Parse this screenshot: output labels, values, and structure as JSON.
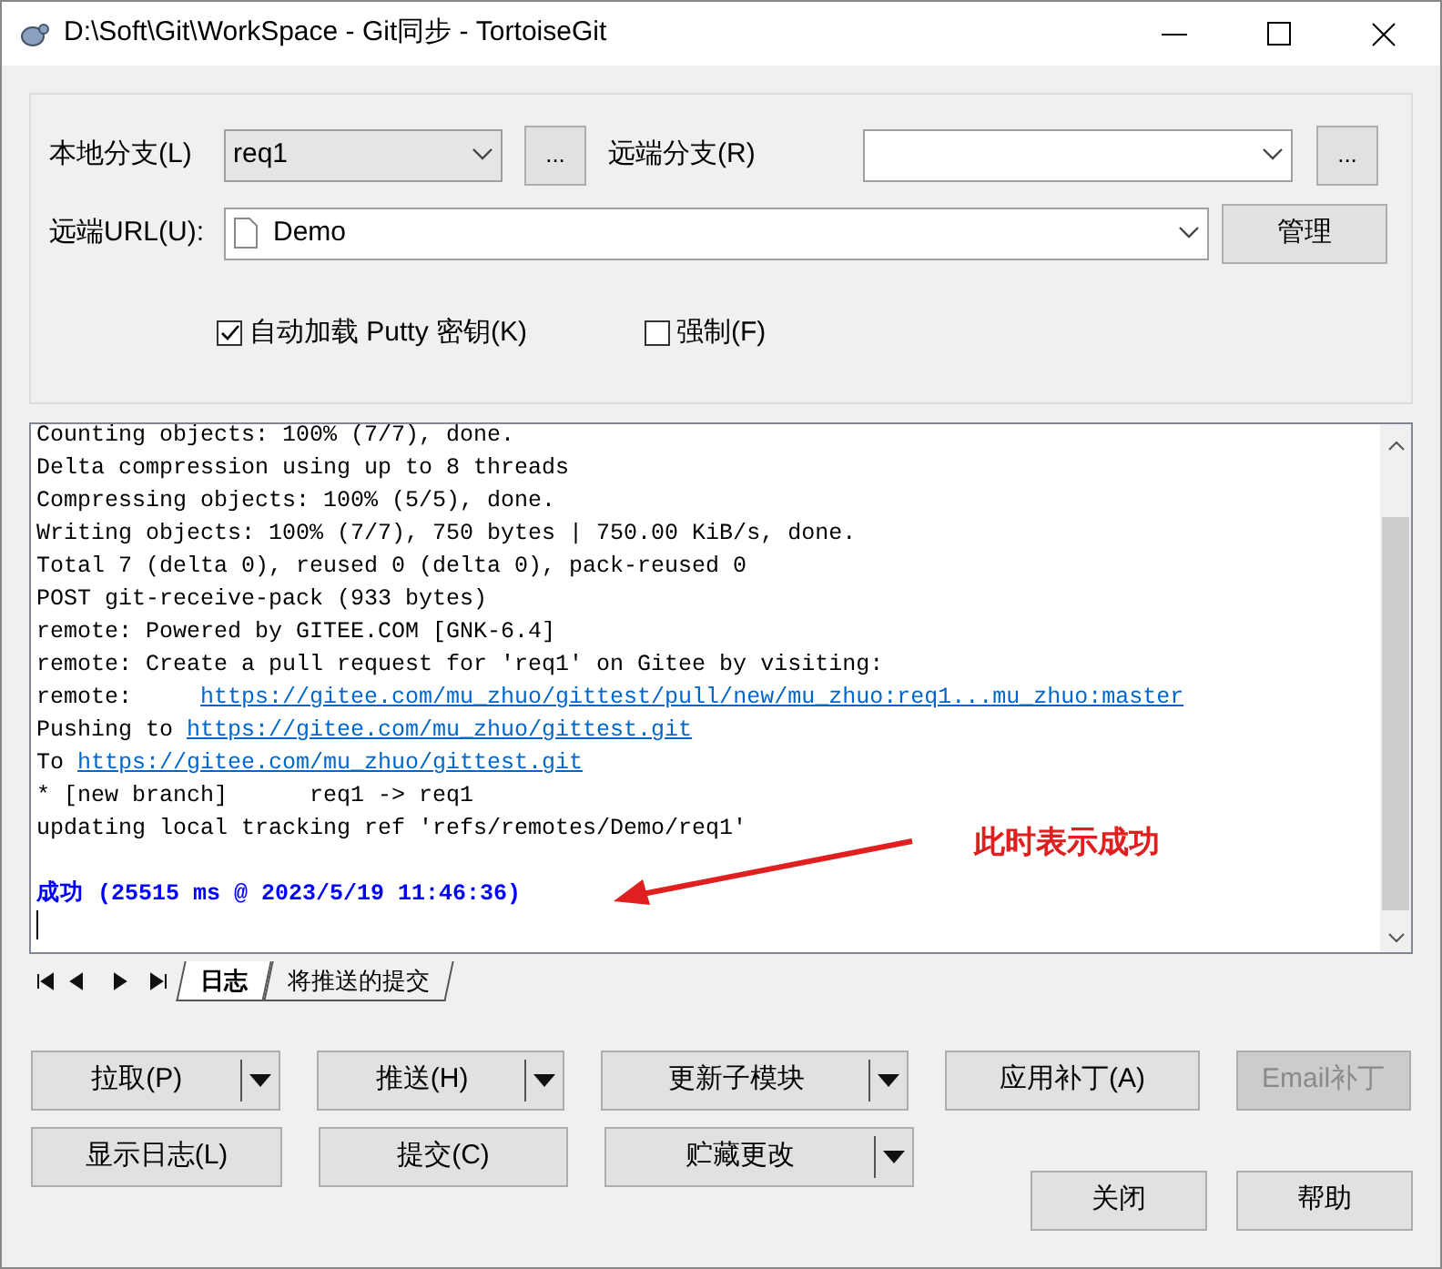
{
  "window": {
    "title": "D:\\Soft\\Git\\WorkSpace - Git同步 - TortoiseGit"
  },
  "local_branch": {
    "label": "本地分支(L)",
    "value": "req1",
    "browse": "..."
  },
  "remote_branch": {
    "label": "远端分支(R)",
    "browse": "..."
  },
  "remote_url": {
    "label": "远端URL(U):",
    "value": "Demo",
    "manage": "管理"
  },
  "options": [
    {
      "label": "自动加载 Putty 密钥(K)",
      "checked": true
    },
    {
      "label": "强制(F)",
      "checked": false
    }
  ],
  "log": [
    {
      "text": "Counting objects: 100% (7/7), done."
    },
    {
      "text": "Delta compression using up to 8 threads"
    },
    {
      "text": "Compressing objects: 100% (5/5), done."
    },
    {
      "text": "Writing objects: 100% (7/7), 750 bytes | 750.00 KiB/s, done."
    },
    {
      "text": "Total 7 (delta 0), reused 0 (delta 0), pack-reused 0"
    },
    {
      "text": "POST git-receive-pack (933 bytes)"
    },
    {
      "text": "remote: Powered by GITEE.COM [GNK-6.4]"
    },
    {
      "text": "remote: Create a pull request for 'req1' on Gitee by visiting:"
    },
    {
      "text": "remote:     ",
      "link": "https://gitee.com/mu_zhuo/gittest/pull/new/mu_zhuo:req1...mu_zhuo:master"
    },
    {
      "text": "Pushing to ",
      "link": "https://gitee.com/mu_zhuo/gittest.git"
    },
    {
      "text": "To ",
      "link": "https://gitee.com/mu_zhuo/gittest.git"
    },
    {
      "text": "* [new branch]      req1 -> req1"
    },
    {
      "text": "updating local tracking ref 'refs/remotes/Demo/req1'"
    },
    {
      "kind": "blank"
    },
    {
      "text": "成功 (25515 ms @ 2023/5/19 11:46:36)",
      "kind": "status"
    }
  ],
  "annotation": {
    "text": "此时表示成功"
  },
  "tabs": [
    {
      "label": "日志",
      "selected": true
    },
    {
      "label": "将推送的提交",
      "selected": false
    }
  ],
  "button_rows": [
    [
      {
        "label": "拉取(P)",
        "kind": "split",
        "disabled": false
      },
      {
        "label": "推送(H)",
        "kind": "split",
        "disabled": false
      },
      {
        "label": "更新子模块",
        "kind": "split",
        "disabled": false
      },
      {
        "label": "应用补丁(A)",
        "kind": "plain",
        "disabled": false
      },
      {
        "label": "Email补丁",
        "kind": "plain",
        "disabled": true
      }
    ],
    [
      {
        "label": "显示日志(L)",
        "kind": "plain",
        "disabled": false
      },
      {
        "label": "提交(C)",
        "kind": "plain",
        "disabled": false
      },
      {
        "label": "贮藏更改",
        "kind": "split",
        "disabled": false
      }
    ]
  ],
  "dialog_buttons": [
    "关闭",
    "帮助"
  ]
}
